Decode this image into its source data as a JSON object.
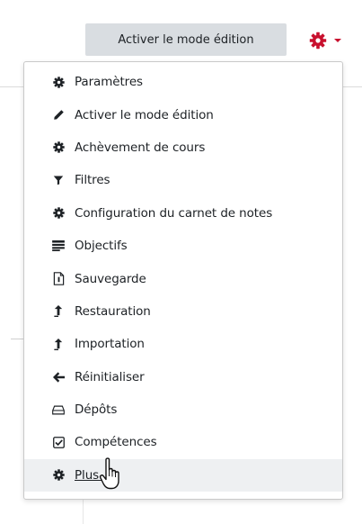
{
  "header": {
    "edit_mode_label": "Activer le mode édition",
    "settings_icon": "gear-icon",
    "accent_color": "#c8102e"
  },
  "menu": {
    "items": [
      {
        "label": "Paramètres",
        "icon": "gear-icon"
      },
      {
        "label": "Activer le mode édition",
        "icon": "pencil-icon"
      },
      {
        "label": "Achèvement de cours",
        "icon": "gear-icon"
      },
      {
        "label": "Filtres",
        "icon": "filter-icon"
      },
      {
        "label": "Configuration du carnet de notes",
        "icon": "gear-icon"
      },
      {
        "label": "Objectifs",
        "icon": "list-icon"
      },
      {
        "label": "Sauvegarde",
        "icon": "file-icon"
      },
      {
        "label": "Restauration",
        "icon": "upload-icon"
      },
      {
        "label": "Importation",
        "icon": "upload-icon"
      },
      {
        "label": "Réinitialiser",
        "icon": "arrow-left-icon"
      },
      {
        "label": "Dépôts",
        "icon": "drive-icon"
      },
      {
        "label": "Compétences",
        "icon": "checkbox-icon"
      },
      {
        "label": "Plus...",
        "icon": "gear-icon"
      }
    ],
    "hovered_item": "Plus..."
  },
  "cursor": {
    "type": "hand-pointer-icon"
  }
}
